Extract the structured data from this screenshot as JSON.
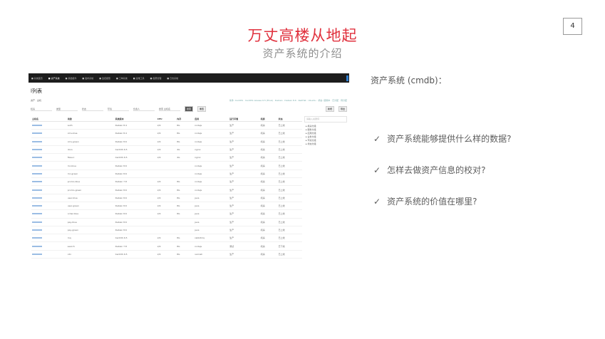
{
  "page_number": "4",
  "title": "万丈高楼从地起",
  "subtitle": "资产系统的介绍",
  "right": {
    "heading": "资产系统 (cmdb)：",
    "check_glyph": "✓",
    "points": [
      "资产系统能够提供什么样的数据?",
      "怎样去做资产信息的校对?",
      "资产系统的价值在哪里?"
    ]
  },
  "screenshot": {
    "nav": [
      "■ 系统首页",
      "■ 资产系统",
      "■ 基础组件",
      "■ 发布系统",
      "■ 监控报警",
      "■ 工单系统",
      "■ 运维工具",
      "■ 权限管理",
      "■ 日志系统"
    ],
    "heading": "l列表",
    "breadcrumb": "资产 · 主机",
    "filter_tags": "条件: CentOS · CentOS release 6.5 (Final) · Debian · Debian 8.6 · RedHat · Ubuntu · 状态: 使用中 · 已分配 · 待分配",
    "selects": [
      "机房",
      "类型",
      "状态",
      "环境",
      "负责人"
    ],
    "search_placeholder": "搜索 主机名",
    "btn_search": "搜索",
    "btn_reset": "重置",
    "btn_add": "新增",
    "btn_export": "导出",
    "columns": [
      "主机名",
      "用途",
      "系统版本",
      "CPU",
      "内存",
      "应用",
      "运行环境",
      "机房",
      "状态"
    ],
    "rows": [
      [
        "auth",
        "Debian 8.4",
        "2/4",
        "8G",
        "nodejs",
        "生产",
        "机房",
        "已上线"
      ],
      [
        "cms-blue",
        "Debian 8.4",
        "2/4",
        "8G",
        "nodejs",
        "生产",
        "机房",
        "已上线"
      ],
      [
        "cms-green",
        "Debian 8.6",
        "2/4",
        "8G",
        "nodejs",
        "生产",
        "机房",
        "已上线"
      ],
      [
        "docs",
        "CentOS 6.5",
        "2/4",
        "4G",
        "nginx",
        "生产",
        "机房",
        "已上线"
      ],
      [
        "filesvc",
        "CentOS 6.5",
        "2/4",
        "4G",
        "nginx",
        "生产",
        "机房",
        "已上线"
      ],
      [
        "mc-blue",
        "Debian 8.6",
        "",
        "",
        "nodejs",
        "生产",
        "机房",
        "已上线"
      ],
      [
        "mc-green",
        "Debian 8.6",
        "",
        "",
        "nodejs",
        "生产",
        "机房",
        "已上线"
      ],
      [
        "promo-blue",
        "Debian 7.8",
        "2/4",
        "8G",
        "nodejs",
        "生产",
        "机房",
        "已上线"
      ],
      [
        "promo-green",
        "Debian 8.6",
        "2/4",
        "8G",
        "nodejs",
        "生产",
        "机房",
        "已上线"
      ],
      [
        "user-blue",
        "Debian 8.6",
        "2/4",
        "8G",
        "java",
        "生产",
        "机房",
        "已上线"
      ],
      [
        "user-green",
        "Debian 8.6",
        "2/4",
        "8G",
        "java",
        "生产",
        "机房",
        "已上线"
      ],
      [
        "order-blue",
        "Debian 8.6",
        "2/4",
        "8G",
        "java",
        "生产",
        "机房",
        "已上线"
      ],
      [
        "pay-blue",
        "Debian 8.6",
        "",
        "",
        "java",
        "生产",
        "机房",
        "已上线"
      ],
      [
        "pay-green",
        "Debian 8.6",
        "",
        "",
        "java",
        "生产",
        "机房",
        "已上线"
      ],
      [
        "mq",
        "CentOS 6.5",
        "2/4",
        "8G",
        "rabbitmq",
        "生产",
        "机房",
        "已上线"
      ],
      [
        "search",
        "Debian 7.8",
        "2/4",
        "8G",
        "nodejs",
        "测试",
        "机房",
        "已下线"
      ],
      [
        "cdn",
        "CentOS 6.5",
        "2/4",
        "8G",
        "varnish",
        "生产",
        "机房",
        "已上线"
      ]
    ],
    "side_search": "请输入关键词",
    "side_tree": [
      "▸ 机房分组",
      "▸ 服务分组",
      "▸ 应用分组",
      "▸ 业务分组",
      "▸ 环境分组",
      "▸ 状态分组"
    ]
  }
}
